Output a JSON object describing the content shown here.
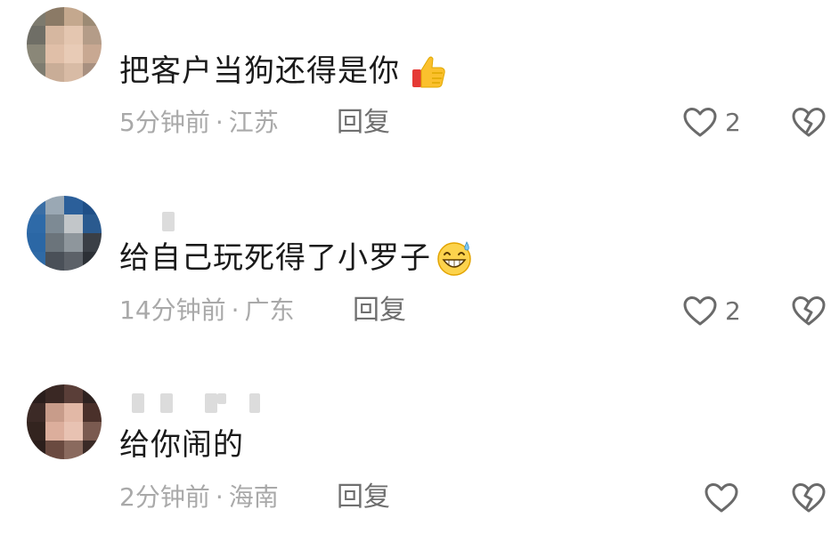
{
  "comments": [
    {
      "text": "把客户当狗还得是你",
      "emoji": "thumbs-up",
      "time": "5分钟前",
      "separator": "·",
      "location": "江苏",
      "reply_label": "回复",
      "like_count": "2"
    },
    {
      "text": "给自己玩死得了小罗子",
      "emoji": "grinning-sweat",
      "time": "14分钟前",
      "separator": "·",
      "location": "广东",
      "reply_label": "回复",
      "like_count": "2"
    },
    {
      "text": "给你闹的",
      "emoji": "",
      "time": "2分钟前",
      "separator": "·",
      "location": "海南",
      "reply_label": "回复",
      "like_count": ""
    }
  ],
  "colors": {
    "text": "#1a1a1a",
    "meta": "#a9a9a9",
    "reply": "#6f6f6f",
    "icon_stroke": "#6a6a6a"
  }
}
